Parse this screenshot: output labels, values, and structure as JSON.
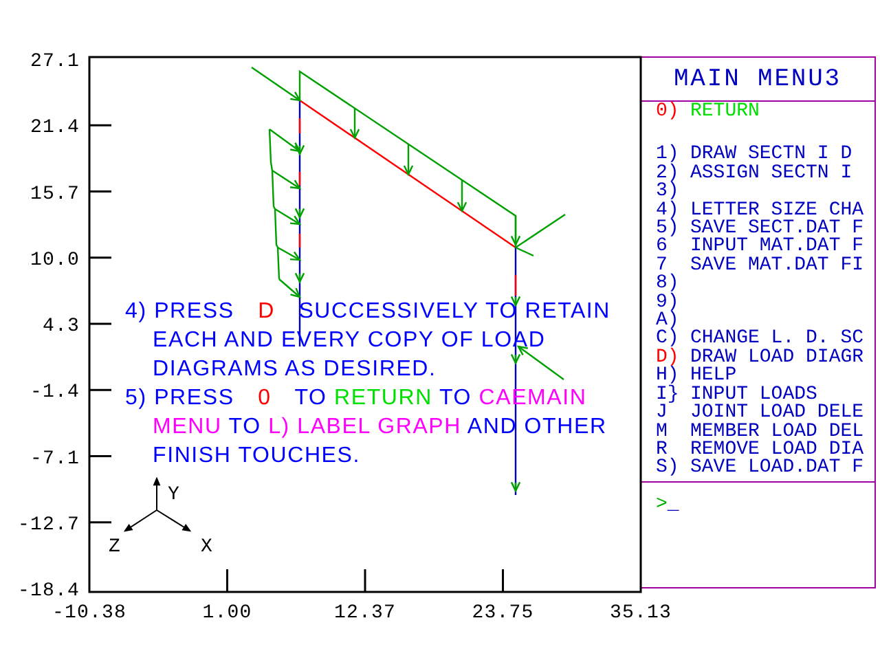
{
  "plot": {
    "y_ticks": [
      "27.1",
      "21.4",
      "15.7",
      "10.0",
      "4.3",
      "-1.4",
      "-7.1",
      "-12.7",
      "-18.4"
    ],
    "x_ticks": [
      "-10.38",
      "1.00",
      "12.37",
      "23.75",
      "35.13"
    ],
    "triad": {
      "y": "Y",
      "z": "Z",
      "x": "X"
    }
  },
  "instructions": [
    {
      "lines": [
        [
          {
            "text": "4) PRESS",
            "kind": "plain"
          },
          {
            "text": "D",
            "kind": "key"
          },
          {
            "text": "SUCCESSIVELY TO RETAIN",
            "kind": "plain"
          }
        ],
        [
          {
            "text": "EACH AND EVERY COPY OF LOAD",
            "kind": "plain"
          }
        ],
        [
          {
            "text": "DIAGRAMS AS DESIRED.",
            "kind": "plain"
          }
        ]
      ]
    },
    {
      "lines": [
        [
          {
            "text": "5) PRESS",
            "kind": "plain"
          },
          {
            "text": "0",
            "kind": "key"
          },
          {
            "text": "TO",
            "kind": "plain"
          },
          {
            "text": "RETURN",
            "kind": "command"
          },
          {
            "text": "TO",
            "kind": "plain"
          },
          {
            "text": "CAEMAIN",
            "kind": "target"
          }
        ],
        [
          {
            "text": "MENU",
            "kind": "target"
          },
          {
            "text": "TO",
            "kind": "plain"
          },
          {
            "text": "L) LABEL GRAPH",
            "kind": "target"
          },
          {
            "text": "AND OTHER",
            "kind": "plain"
          }
        ],
        [
          {
            "text": "FINISH TOUCHES.",
            "kind": "plain"
          }
        ]
      ]
    }
  ],
  "menu": {
    "title": "MAIN MENU3",
    "items": [
      {
        "key": "0)",
        "label": "RETURN",
        "kind": "return",
        "highlighted": true
      },
      {
        "key": "1)",
        "label": "DRAW SECTN I D",
        "kind": "command",
        "highlighted": false
      },
      {
        "key": "2)",
        "label": "ASSIGN SECTN I",
        "kind": "command",
        "highlighted": false
      },
      {
        "key": "3)",
        "kind": "command",
        "highlighted": false
      },
      {
        "key": "4)",
        "label": "LETTER SIZE CHA",
        "kind": "command",
        "highlighted": false
      },
      {
        "key": "5)",
        "label": "SAVE SECT.DAT F",
        "kind": "command",
        "highlighted": false
      },
      {
        "key": "6",
        "label": "INPUT MAT.DAT F",
        "kind": "command",
        "highlighted": false
      },
      {
        "key": "7",
        "label": "SAVE MAT.DAT FI",
        "kind": "command",
        "highlighted": false
      },
      {
        "key": "8)",
        "kind": "command",
        "highlighted": false
      },
      {
        "key": "9)",
        "kind": "command",
        "highlighted": false
      },
      {
        "key": "A)",
        "kind": "command",
        "highlighted": false
      },
      {
        "key": "C)",
        "label": "CHANGE L. D. SC",
        "kind": "command",
        "highlighted": false
      },
      {
        "key": "D)",
        "label": "DRAW LOAD DIAGR",
        "kind": "command",
        "highlighted": true
      },
      {
        "key": "H)",
        "label": "HELP",
        "kind": "command",
        "highlighted": false
      },
      {
        "key": "I}",
        "label": "INPUT LOADS",
        "kind": "command",
        "highlighted": false
      },
      {
        "key": "J",
        "label": "JOINT LOAD DELE",
        "kind": "command",
        "highlighted": false
      },
      {
        "key": "M",
        "label": "MEMBER LOAD DEL",
        "kind": "command",
        "highlighted": false
      },
      {
        "key": "R",
        "label": "REMOVE LOAD DIA",
        "kind": "command",
        "highlighted": false
      },
      {
        "key": "S)",
        "label": "SAVE LOAD.DAT F",
        "kind": "command",
        "highlighted": false
      }
    ]
  },
  "prompt": {
    "symbol": ">",
    "cursor": "_"
  }
}
